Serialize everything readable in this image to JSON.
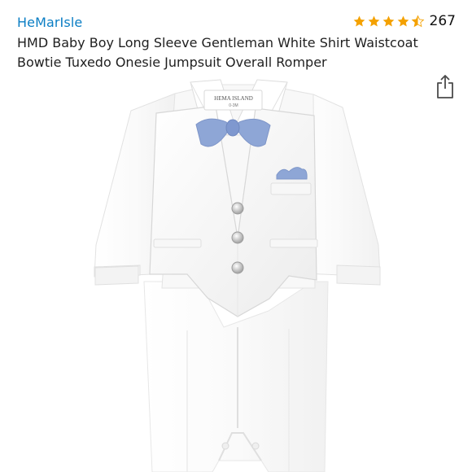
{
  "product": {
    "brand": "HeMarIsle",
    "title": "HMD Baby Boy Long Sleeve Gentleman White Shirt Waistcoat Bowtie Tuxedo Onesie Jumpsuit Overall Romper",
    "rating": 4.5,
    "review_count": "267",
    "label_text": "HEMA ISLAND",
    "label_size": "0-3M"
  },
  "colors": {
    "brand_link": "#0b7ec4",
    "star": "#f4a100",
    "bowtie": "#8ea6d6"
  },
  "icons": {
    "share": "share-icon",
    "star": "star-icon"
  }
}
